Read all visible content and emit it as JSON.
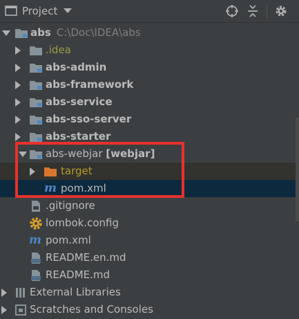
{
  "header": {
    "title": "Project"
  },
  "tree": {
    "root": {
      "name": "abs",
      "path": "C:\\Doc\\IDEA\\abs"
    },
    "idea": ".idea",
    "modules": [
      "abs-admin",
      "abs-framework",
      "abs-service",
      "abs-sso-server",
      "abs-starter"
    ],
    "webjar": {
      "name": "abs-webjar",
      "tag": "[webjar]",
      "target": "target",
      "pom": "pom.xml"
    },
    "files": [
      ".gitignore",
      "lombok.config",
      "pom.xml",
      "README.en.md",
      "README.md"
    ],
    "external_libraries": "External Libraries",
    "scratches": "Scratches and Consoles"
  }
}
